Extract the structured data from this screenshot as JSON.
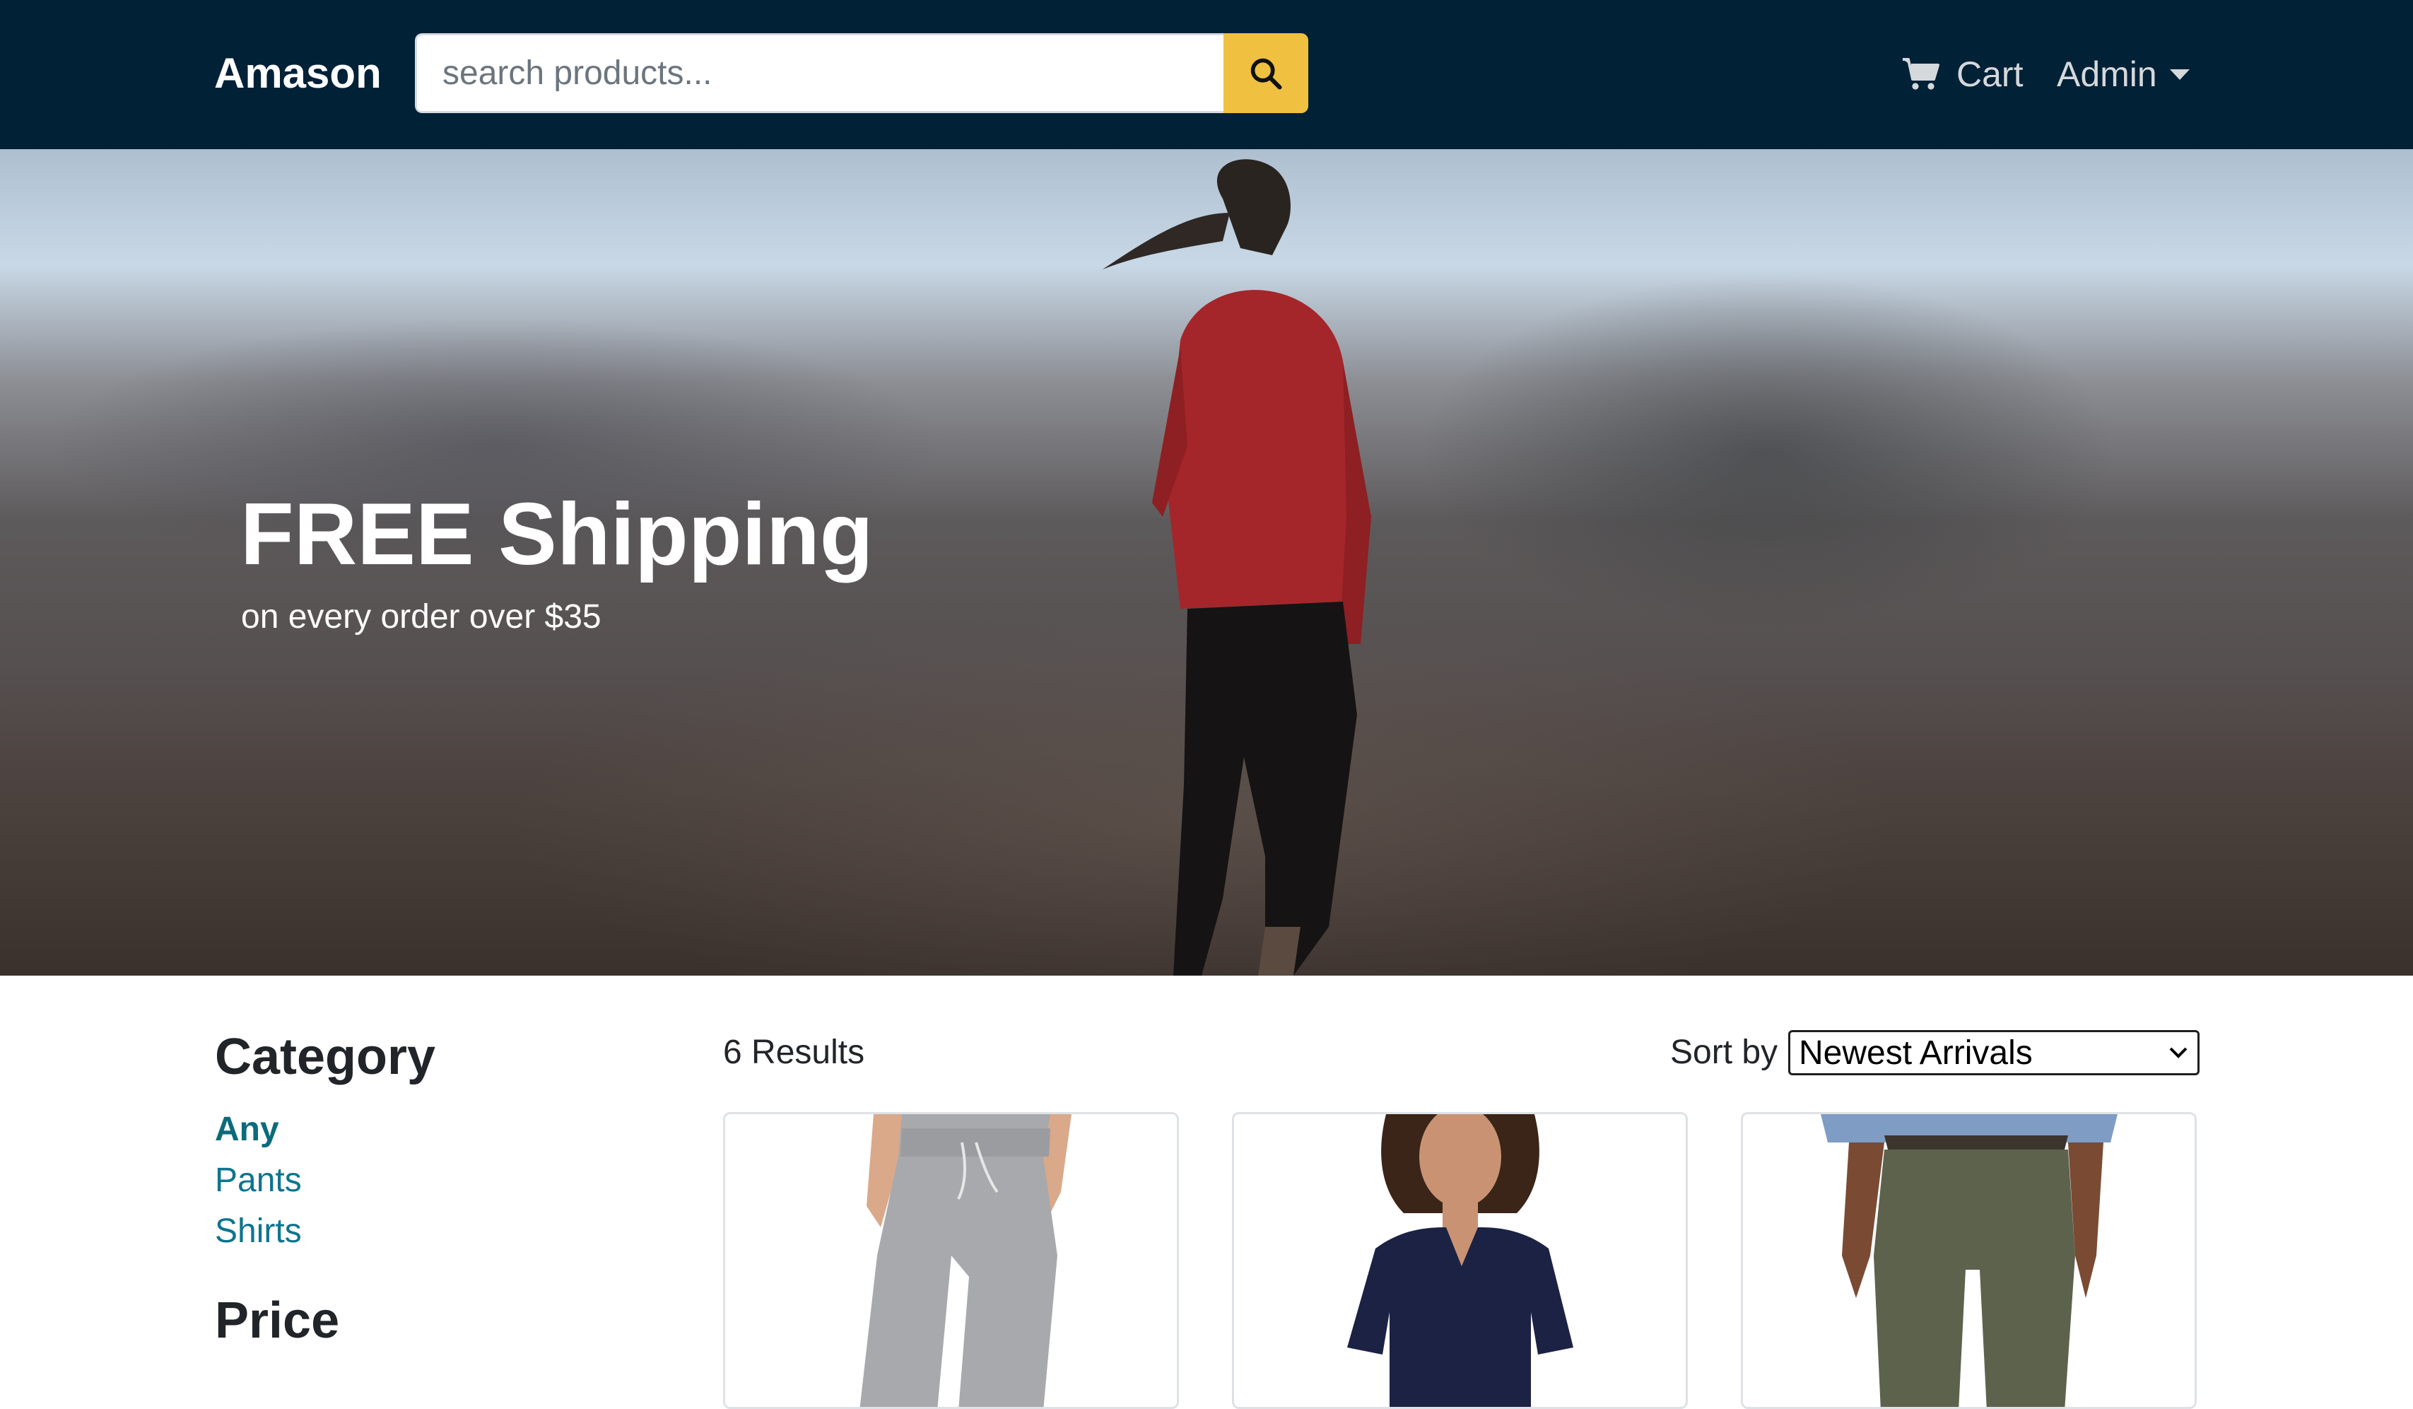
{
  "navbar": {
    "brand": "Amason",
    "search_placeholder": "search products...",
    "search_icon": "search-icon",
    "cart_label": "Cart",
    "cart_icon": "cart-icon",
    "user_label": "Admin"
  },
  "hero": {
    "title": "FREE Shipping",
    "subtitle": "on every order over $35"
  },
  "sidebar": {
    "category_heading": "Category",
    "categories": [
      "Any",
      "Pants",
      "Shirts"
    ],
    "selected_category": "Any",
    "price_heading": "Price"
  },
  "results": {
    "count_label": "6 Results",
    "sort_label": "Sort by",
    "sort_selected": "Newest Arrivals"
  },
  "colors": {
    "navbar": "#012137",
    "search_button": "#f0c040",
    "link": "#0e7490"
  }
}
